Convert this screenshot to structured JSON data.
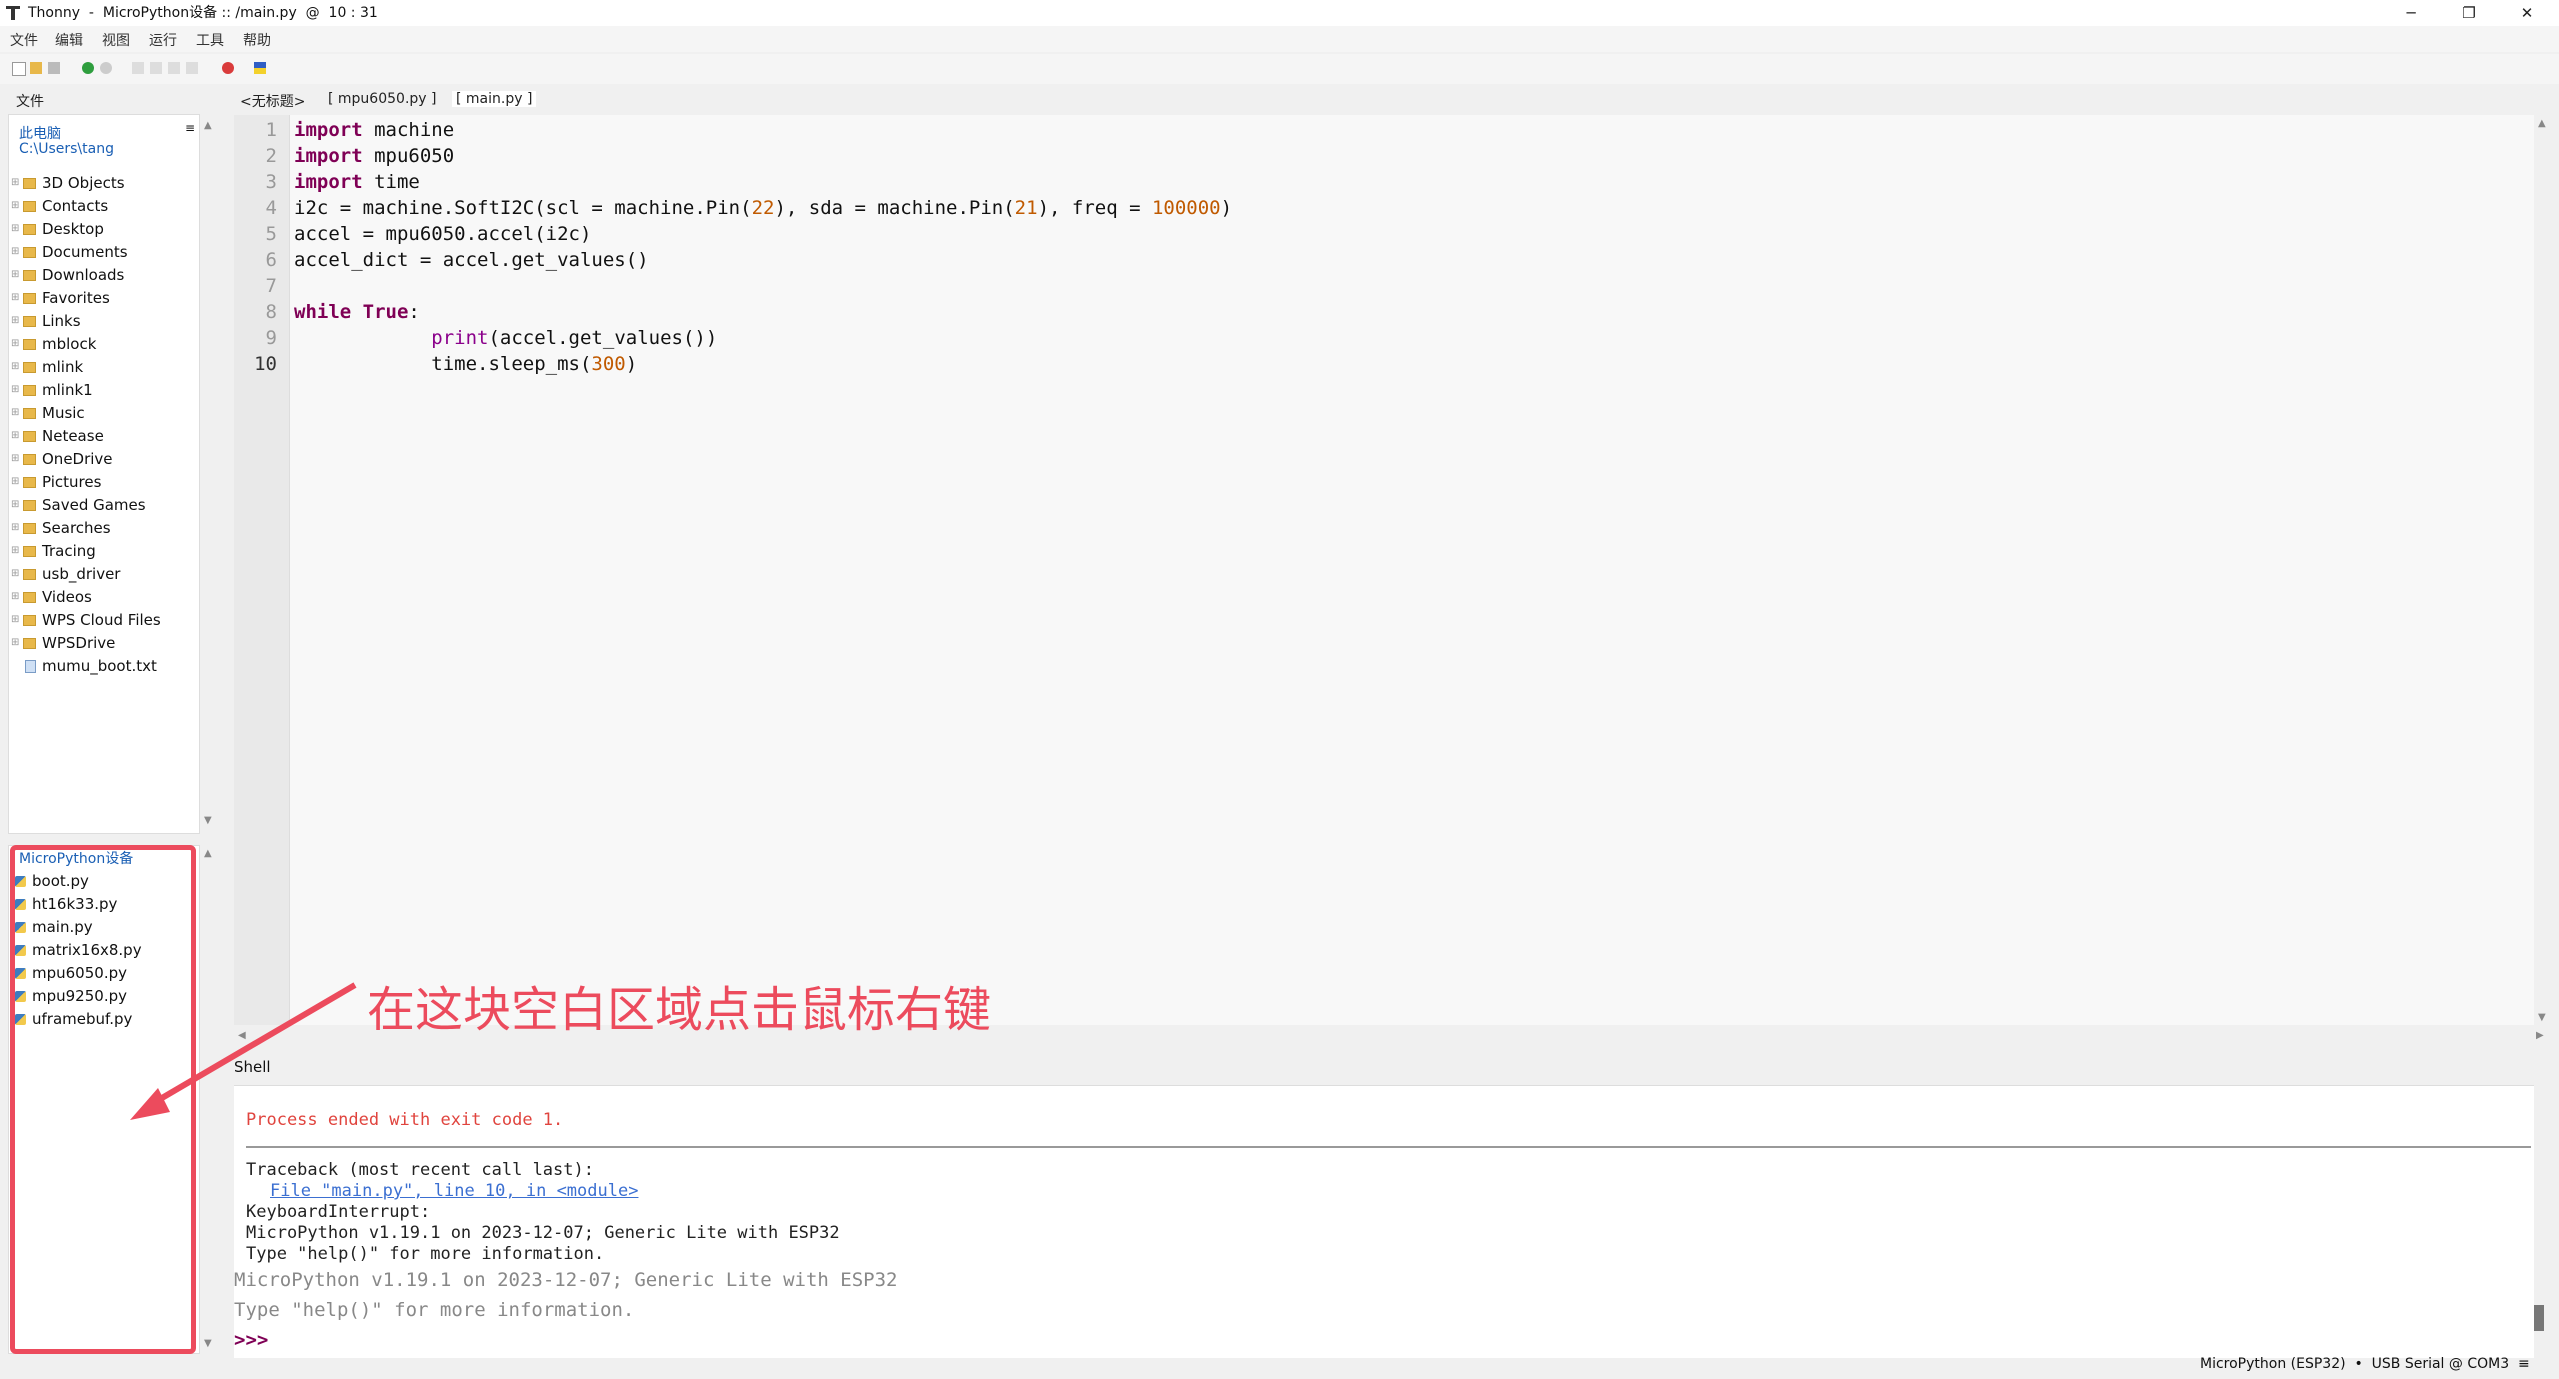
{
  "window": {
    "title": "Thonny  -  MicroPython设备 :: /main.py  @  10 : 31"
  },
  "menu": [
    "文件",
    "编辑",
    "视图",
    "运行",
    "工具",
    "帮助"
  ],
  "files_panel": {
    "tab_label": "文件",
    "local": {
      "header": "此电脑",
      "path": "C:\\Users\\tang",
      "items": [
        {
          "name": "3D Objects",
          "type": "folder"
        },
        {
          "name": "Contacts",
          "type": "folder"
        },
        {
          "name": "Desktop",
          "type": "folder"
        },
        {
          "name": "Documents",
          "type": "folder"
        },
        {
          "name": "Downloads",
          "type": "folder"
        },
        {
          "name": "Favorites",
          "type": "folder"
        },
        {
          "name": "Links",
          "type": "folder"
        },
        {
          "name": "mblock",
          "type": "folder"
        },
        {
          "name": "mlink",
          "type": "folder"
        },
        {
          "name": "mlink1",
          "type": "folder"
        },
        {
          "name": "Music",
          "type": "folder"
        },
        {
          "name": "Netease",
          "type": "folder"
        },
        {
          "name": "OneDrive",
          "type": "folder"
        },
        {
          "name": "Pictures",
          "type": "folder"
        },
        {
          "name": "Saved Games",
          "type": "folder"
        },
        {
          "name": "Searches",
          "type": "folder"
        },
        {
          "name": "Tracing",
          "type": "folder"
        },
        {
          "name": "usb_driver",
          "type": "folder"
        },
        {
          "name": "Videos",
          "type": "folder"
        },
        {
          "name": "WPS Cloud Files",
          "type": "folder"
        },
        {
          "name": "WPSDrive",
          "type": "folder"
        },
        {
          "name": "mumu_boot.txt",
          "type": "file"
        }
      ]
    },
    "device": {
      "header": "MicroPython设备",
      "items": [
        {
          "name": "boot.py"
        },
        {
          "name": "ht16k33.py"
        },
        {
          "name": "main.py"
        },
        {
          "name": "matrix16x8.py"
        },
        {
          "name": "mpu6050.py"
        },
        {
          "name": "mpu9250.py"
        },
        {
          "name": "uframebuf.py"
        }
      ]
    }
  },
  "editor": {
    "tabs": [
      "<无标题>",
      "[ mpu6050.py ]",
      "[ main.py ]"
    ],
    "line_numbers": [
      "1",
      "2",
      "3",
      "4",
      "5",
      "6",
      "7",
      "8",
      "9",
      "10"
    ],
    "code": {
      "l1_kw": "import",
      "l1_rest": " machine",
      "l2_kw": "import",
      "l2_rest": " mpu6050",
      "l3_kw": "import",
      "l3_rest": " time",
      "l4_a": "i2c = machine.SoftI2C(scl = machine.Pin(",
      "l4_n1": "22",
      "l4_b": "), sda = machine.Pin(",
      "l4_n2": "21",
      "l4_c": "), freq = ",
      "l4_n3": "100000",
      "l4_d": ")",
      "l5": "accel = mpu6050.accel(i2c)",
      "l6": "accel_dict = accel.get_values()",
      "l8_kw1": "while",
      "l8_sp": " ",
      "l8_kw2": "True",
      "l8_colon": ":",
      "l9_indent": "            ",
      "l9_bi": "print",
      "l9_rest": "(accel.get_values())",
      "l10_a": "            time.sleep_ms(",
      "l10_n": "300",
      "l10_b": ")"
    }
  },
  "shell": {
    "tab_label": "Shell",
    "process_ended": "Process ended with exit code 1.",
    "traceback": "Traceback (most recent call last):",
    "file_link": "File \"main.py\", line 10, in <module>",
    "interrupt": "KeyboardInterrupt:",
    "banner1": "MicroPython v1.19.1 on 2023-12-07; Generic Lite with ESP32",
    "banner2": "Type \"help()\" for more information.",
    "banner1_repeat": "MicroPython v1.19.1 on 2023-12-07; Generic Lite with ESP32",
    "banner2_repeat": "Type \"help()\" for more information.",
    "prompt": ">>>"
  },
  "status_bar": "MicroPython (ESP32)  •  USB Serial @ COM3  ≡",
  "annotation": {
    "text": "在这块空白区域点击鼠标右键",
    "color": "#ec4b5d"
  },
  "colors": {
    "keyword": "#7f0055",
    "number": "#c05a00",
    "error": "#e0443e",
    "link": "#3b6fd1"
  }
}
